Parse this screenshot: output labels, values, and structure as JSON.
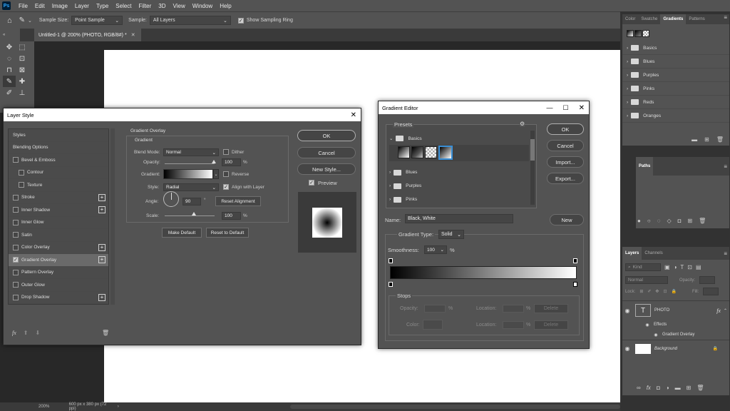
{
  "app": {
    "logo": "Ps",
    "menu": [
      "File",
      "Edit",
      "Image",
      "Layer",
      "Type",
      "Select",
      "Filter",
      "3D",
      "View",
      "Window",
      "Help"
    ]
  },
  "options_bar": {
    "sample_size_label": "Sample Size:",
    "sample_size_value": "Point Sample",
    "sample_label": "Sample:",
    "sample_value": "All Layers",
    "show_ring_label": "Show Sampling Ring"
  },
  "document": {
    "tab_title": "Untitled-1 @ 200% (PHOTO, RGB/8#) *",
    "zoom": "200%",
    "dimensions": "600 px x 380 px (72 ppi)"
  },
  "layer_style": {
    "title": "Layer Style",
    "items": [
      {
        "label": "Styles",
        "checkbox": false,
        "checked": false,
        "plus": false,
        "indent": false
      },
      {
        "label": "Blending Options",
        "checkbox": false,
        "checked": false,
        "plus": false,
        "indent": false
      },
      {
        "label": "Bevel & Emboss",
        "checkbox": true,
        "checked": false,
        "plus": false,
        "indent": false
      },
      {
        "label": "Contour",
        "checkbox": true,
        "checked": false,
        "plus": false,
        "indent": true
      },
      {
        "label": "Texture",
        "checkbox": true,
        "checked": false,
        "plus": false,
        "indent": true
      },
      {
        "label": "Stroke",
        "checkbox": true,
        "checked": false,
        "plus": true,
        "indent": false
      },
      {
        "label": "Inner Shadow",
        "checkbox": true,
        "checked": false,
        "plus": true,
        "indent": false
      },
      {
        "label": "Inner Glow",
        "checkbox": true,
        "checked": false,
        "plus": false,
        "indent": false
      },
      {
        "label": "Satin",
        "checkbox": true,
        "checked": false,
        "plus": false,
        "indent": false
      },
      {
        "label": "Color Overlay",
        "checkbox": true,
        "checked": false,
        "plus": true,
        "indent": false
      },
      {
        "label": "Gradient Overlay",
        "checkbox": true,
        "checked": true,
        "plus": true,
        "indent": false,
        "selected": true
      },
      {
        "label": "Pattern Overlay",
        "checkbox": true,
        "checked": false,
        "plus": false,
        "indent": false
      },
      {
        "label": "Outer Glow",
        "checkbox": true,
        "checked": false,
        "plus": false,
        "indent": false
      },
      {
        "label": "Drop Shadow",
        "checkbox": true,
        "checked": false,
        "plus": true,
        "indent": false
      }
    ],
    "section_title": "Gradient Overlay",
    "group_title": "Gradient",
    "blend_mode_label": "Blend Mode:",
    "blend_mode_value": "Normal",
    "dither_label": "Dither",
    "opacity_label": "Opacity:",
    "opacity_value": "100",
    "percent": "%",
    "gradient_label": "Gradient:",
    "reverse_label": "Reverse",
    "style_label": "Style:",
    "style_value": "Radial",
    "align_label": "Align with Layer",
    "angle_label": "Angle:",
    "angle_value": "90",
    "degree": "°",
    "reset_alignment": "Reset Alignment",
    "scale_label": "Scale:",
    "scale_value": "100",
    "make_default": "Make Default",
    "reset_default": "Reset to Default",
    "ok": "OK",
    "cancel": "Cancel",
    "new_style": "New Style...",
    "preview_label": "Preview",
    "fx": "fx"
  },
  "gradient_editor": {
    "title": "Gradient Editor",
    "presets_label": "Presets",
    "folders": [
      "Basics",
      "Blues",
      "Purples",
      "Pinks"
    ],
    "ok": "OK",
    "cancel": "Cancel",
    "import": "Import...",
    "export": "Export...",
    "name_label": "Name:",
    "name_value": "Black, White",
    "new": "New",
    "gradient_type_label": "Gradient Type:",
    "gradient_type_value": "Solid",
    "smoothness_label": "Smoothness:",
    "smoothness_value": "100",
    "percent": "%",
    "stops_label": "Stops",
    "opacity_label": "Opacity:",
    "location_label": "Location:",
    "color_label": "Color:",
    "delete": "Delete"
  },
  "gradients_panel": {
    "tabs": [
      "Color",
      "Swatche",
      "Gradients",
      "Patterns"
    ],
    "folders": [
      "Basics",
      "Blues",
      "Purples",
      "Pinks",
      "Reds",
      "Oranges"
    ]
  },
  "paths_panel": {
    "title": "Paths"
  },
  "layers_panel": {
    "tabs": [
      "Layers",
      "Channels"
    ],
    "kind_label": "Kind",
    "blend_value": "Normal",
    "opacity_label": "Opacity:",
    "lock_label": "Lock:",
    "fill_label": "Fill:",
    "layers": {
      "photo": "PHOTO",
      "effects": "Effects",
      "gradient_overlay": "Gradient Overlay",
      "background": "Background"
    },
    "fx": "fx"
  }
}
